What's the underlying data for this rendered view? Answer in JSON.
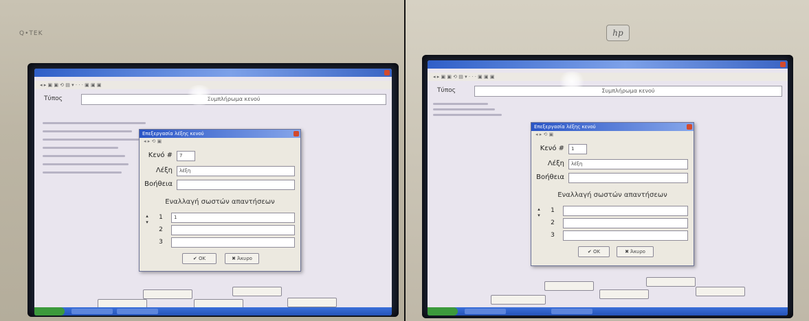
{
  "left_photo": {
    "bezel_label": "Q•TEK",
    "search_label": "Τύπος",
    "search_value": "Συμπλήρωμα κενού",
    "dialog": {
      "title": "Επεξεργασία λέξης κενού",
      "cloze_label": "Κενό #",
      "cloze_value": "7",
      "word_label": "Λέξη",
      "word_value": "λέξη",
      "help_label": "Βοήθεια",
      "help_value": "",
      "alternatives_title": "Εναλλαγή σωστών απαντήσεων",
      "alternatives": [
        {
          "n": "1",
          "value": "1"
        },
        {
          "n": "2",
          "value": ""
        },
        {
          "n": "3",
          "value": ""
        }
      ],
      "ok_label": "✔ OK",
      "cancel_label": "✖ Άκυρο"
    }
  },
  "right_photo": {
    "logo": "hp",
    "search_label": "Τύπος",
    "search_value": "Συμπλήρωμα κενού",
    "dialog": {
      "title": "Επεξεργασία λέξης κενού",
      "cloze_label": "Κενό #",
      "cloze_value": "1",
      "word_label": "Λέξη",
      "word_value": "λέξη",
      "help_label": "Βοήθεια",
      "help_value": "",
      "alternatives_title": "Εναλλαγή σωστών απαντήσεων",
      "alternatives": [
        {
          "n": "1",
          "value": ""
        },
        {
          "n": "2",
          "value": ""
        },
        {
          "n": "3",
          "value": ""
        }
      ],
      "ok_label": "✔ OK",
      "cancel_label": "✖ Άκυρο"
    }
  },
  "colors": {
    "window_title": "#2f5fc8",
    "dialog_bg": "#ece9e0",
    "taskbar": "#2553b8",
    "close_button": "#d34a2d"
  }
}
